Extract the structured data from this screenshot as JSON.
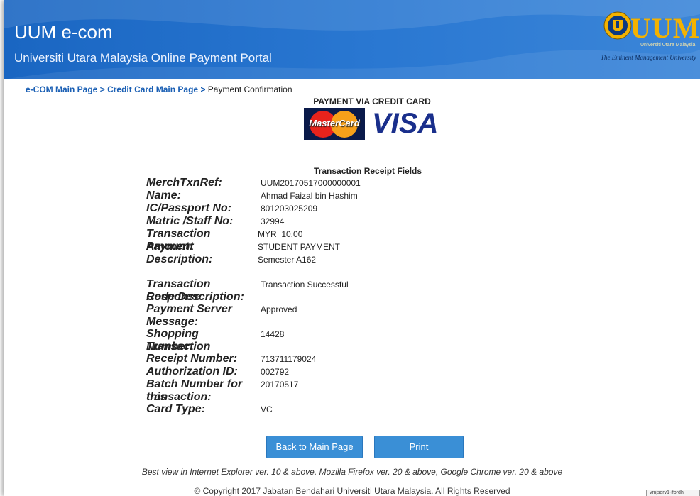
{
  "header": {
    "title": "UUM e-com",
    "subtitle": "Universiti Utara Malaysia Online Payment Portal",
    "logo": {
      "wordmark": "UUM",
      "sub": "Universiti Utara Malaysia",
      "tagline": "The Eminent Management University"
    }
  },
  "breadcrumb": {
    "items": [
      "e-COM Main Page",
      "Credit Card Main Page"
    ],
    "separator": ">",
    "current": "Payment Confirmation"
  },
  "payment": {
    "title": "PAYMENT VIA CREDIT CARD",
    "mastercard_label": "MasterCard",
    "visa_label": "VISA"
  },
  "receipt": {
    "title": "Transaction Receipt Fields",
    "fields": [
      {
        "label": "MerchTxnRef:",
        "value": "UUM20170517000000001"
      },
      {
        "label": "Name:",
        "value": "Ahmad Faizal bin Hashim"
      },
      {
        "label": "IC/Passport No:",
        "value": "801203025209"
      },
      {
        "label": "Matric /Staff No:",
        "value": "32994"
      },
      {
        "label": "Transaction Amount:",
        "value": "MYR  10.00"
      },
      {
        "label": "Payment Description:",
        "value": "STUDENT PAYMENT",
        "value2": "Semester A162"
      },
      {
        "label": "Transaction Response",
        "label2": "Code Description:",
        "value": "Transaction Successful"
      },
      {
        "label": "Payment Server",
        "label2": "Message:",
        "value": "Approved"
      },
      {
        "label": "Shopping Transaction",
        "label2": "Number:",
        "value": "14428"
      },
      {
        "label": "Receipt Number:",
        "value": "713711179024"
      },
      {
        "label": "Authorization ID:",
        "value": "002792"
      },
      {
        "label": "Batch Number for this",
        "label2": "transaction:",
        "value": "20170517"
      },
      {
        "label": "Card Type:",
        "value": "VC"
      }
    ]
  },
  "buttons": {
    "back": "Back to Main Page",
    "print": "Print"
  },
  "footer": {
    "note": "Best view in Internet Explorer ver. 10 & above, Mozilla Firefox ver. 20 & above, Google Chrome ver. 20 & above",
    "copyright": "© Copyright 2017 Jabatan Bendahari Universiti Utara Malaysia. All Rights Reserved",
    "status_box": "vmjserv1-ifordh"
  },
  "colors": {
    "header_blue": "#1a66c2",
    "link_blue": "#1a5fb4",
    "button_blue": "#3a8fd6",
    "logo_gold": "#f3b200"
  }
}
